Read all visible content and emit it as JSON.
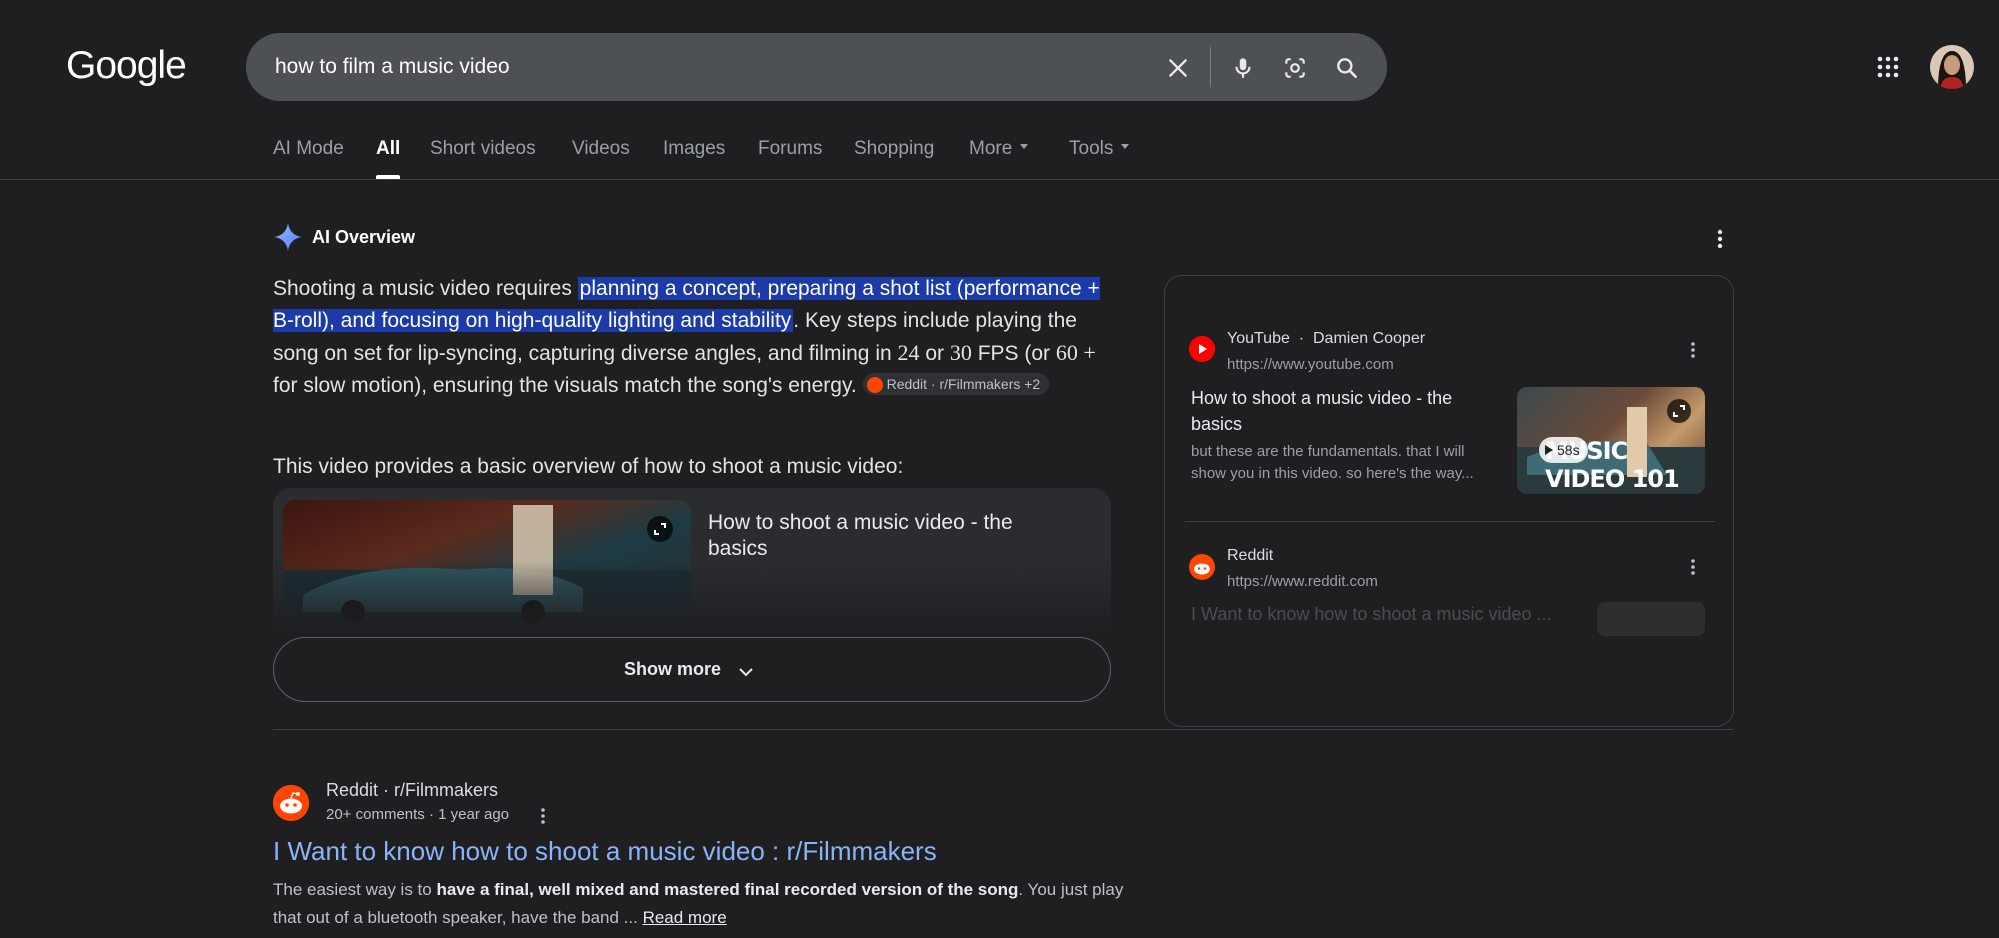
{
  "header": {
    "logo": "Google",
    "search_query": "how to film a music video"
  },
  "tabs": [
    {
      "label": "AI Mode"
    },
    {
      "label": "All",
      "active": true
    },
    {
      "label": "Short videos"
    },
    {
      "label": "Videos"
    },
    {
      "label": "Images"
    },
    {
      "label": "Forums"
    },
    {
      "label": "Shopping"
    },
    {
      "label": "More"
    },
    {
      "label": "Tools"
    }
  ],
  "ai_overview": {
    "title": "AI Overview",
    "para_intro": "Shooting a music video requires ",
    "para_highlight": "planning a concept, preparing a shot list (performance + B-roll), and focusing on high-quality lighting and stability",
    "para_rest_1": ". Key steps include playing the song on set for lip-syncing, capturing diverse angles, and filming in ",
    "num_24": "24",
    "text_or": " or ",
    "num_30": "30",
    "text_fps": " FPS (or ",
    "num_60": "60 +",
    "para_rest_2": " for slow motion), ensuring the visuals match the song's energy.",
    "chip_label": "Reddit · r/Filmmakers +2",
    "para2": "This video provides a basic overview of how to shoot a music video:",
    "video_title": "How to shoot a music video - the basics",
    "show_more": "Show more"
  },
  "sources": [
    {
      "site": "YouTube",
      "author": "Damien Cooper",
      "url": "https://www.youtube.com",
      "title": "How to shoot a music video - the basics",
      "snippet": "but these are the fundamentals. that I will show you in this video. so here's the way...",
      "thumb_text": "MUSIC VIDEO 101",
      "duration": "58s"
    },
    {
      "site": "Reddit",
      "url": "https://www.reddit.com",
      "title": "I Want to know how to shoot a music video ..."
    }
  ],
  "result": {
    "site": "Reddit · r/Filmmakers",
    "meta": "20+ comments · 1 year ago",
    "title": "I Want to know how to shoot a music video : r/Filmmakers",
    "snippet_pre": "The easiest way is to ",
    "snippet_bold": "have a final, well mixed and mastered final recorded version of the song",
    "snippet_post": ". You just play that out of a bluetooth speaker, have the band ... ",
    "read_more": "Read more"
  },
  "colors": {
    "background": "#1f1f22",
    "highlight": "#1c3aa9",
    "link": "#8ab4f8",
    "reddit": "#ff4500",
    "youtube": "#ff0000"
  }
}
